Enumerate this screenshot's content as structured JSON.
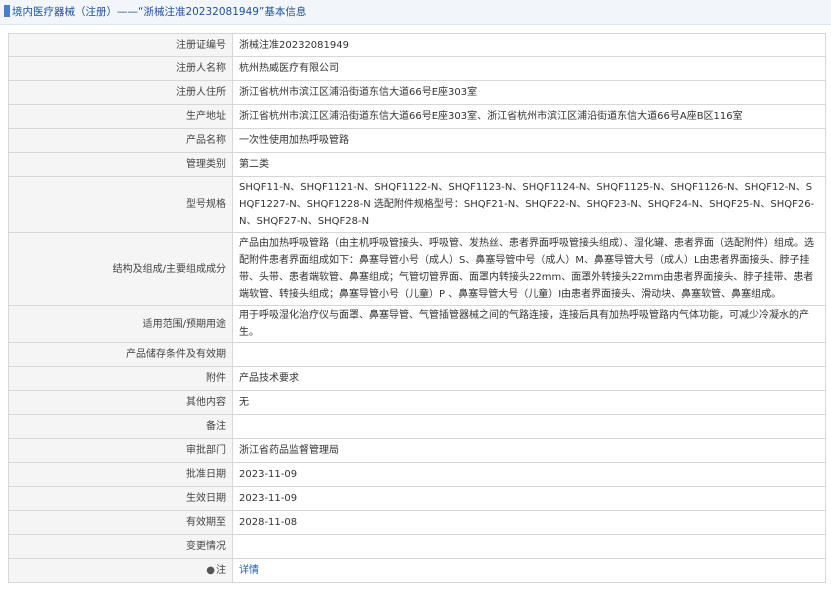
{
  "header": {
    "title": "境内医疗器械（注册）——“浙械注准20232081949”基本信息"
  },
  "rows": [
    {
      "label": "注册证编号",
      "value": "浙械注准20232081949"
    },
    {
      "label": "注册人名称",
      "value": "杭州热威医疗有限公司"
    },
    {
      "label": "注册人住所",
      "value": "浙江省杭州市滨江区浦沿街道东信大道66号E座303室"
    },
    {
      "label": "生产地址",
      "value": "浙江省杭州市滨江区浦沿街道东信大道66号E座303室、浙江省杭州市滨江区浦沿街道东信大道66号A座B区116室"
    },
    {
      "label": "产品名称",
      "value": "一次性使用加热呼吸管路"
    },
    {
      "label": "管理类别",
      "value": "第二类"
    },
    {
      "label": "型号规格",
      "value": "SHQF11-N、SHQF1121-N、SHQF1122-N、SHQF1123-N、SHQF1124-N、SHQF1125-N、SHQF1126-N、SHQF12-N、SHQF1227-N、SHQF1228-N 选配附件规格型号：SHQF21-N、SHQF22-N、SHQF23-N、SHQF24-N、SHQF25-N、SHQF26-N、SHQF27-N、SHQF28-N"
    },
    {
      "label": "结构及组成/主要组成成分",
      "value": "产品由加热呼吸管路（由主机呼吸管接头、呼吸管、发热丝、患者界面呼吸管接头组成）、湿化罐、患者界面（选配附件）组成。选配附件患者界面组成如下：鼻塞导管小号（成人）S、鼻塞导管中号（成人）M、鼻塞导管大号（成人）L由患者界面接头、脖子挂带、头带、患者端软管、鼻塞组成；气管切管界面、面罩内转接头22mm、面罩外转接头22mm由患者界面接头、脖子挂带、患者端软管、转接头组成；鼻塞导管小号（儿童）P 、鼻塞导管大号（儿童）I由患者界面接头、滑动块、鼻塞软管、鼻塞组成。"
    },
    {
      "label": "适用范围/预期用途",
      "value": "用于呼吸湿化治疗仪与面罩、鼻塞导管、气管插管器械之间的气路连接，连接后具有加热呼吸管路内气体功能，可减少冷凝水的产生。"
    },
    {
      "label": "产品储存条件及有效期",
      "value": ""
    },
    {
      "label": "附件",
      "value": "产品技术要求"
    },
    {
      "label": "其他内容",
      "value": "无"
    },
    {
      "label": "备注",
      "value": ""
    },
    {
      "label": "审批部门",
      "value": "浙江省药品监督管理局"
    },
    {
      "label": "批准日期",
      "value": "2023-11-09"
    },
    {
      "label": "生效日期",
      "value": "2023-11-09"
    },
    {
      "label": "有效期至",
      "value": "2028-11-08"
    },
    {
      "label": "变更情况",
      "value": ""
    },
    {
      "label": "注",
      "value": "详情"
    }
  ]
}
